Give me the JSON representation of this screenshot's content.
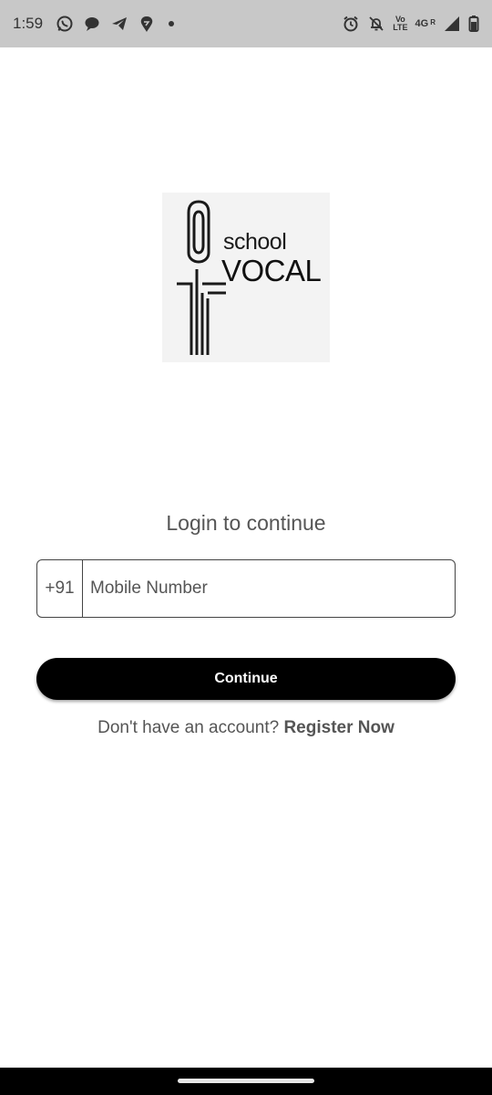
{
  "status_bar": {
    "time": "1:59",
    "left_icons": [
      "whatsapp-icon",
      "chat-bubble-icon",
      "telegram-icon",
      "swiggy-icon",
      "more-dot-icon"
    ],
    "right_icons": [
      "alarm-icon",
      "notification-off-icon",
      "volte-icon",
      "signal-icon",
      "battery-icon"
    ],
    "volte_top": "Vo",
    "volte_bottom": "LTE",
    "network": "4G",
    "roaming": "R"
  },
  "logo": {
    "line1": "school",
    "line2": "VOCAL"
  },
  "login": {
    "heading": "Login to continue",
    "country_code": "+91",
    "mobile_placeholder": "Mobile Number",
    "mobile_value": "",
    "continue_label": "Continue",
    "register_prompt": "Don't have an account? ",
    "register_link": "Register Now"
  },
  "colors": {
    "primary_button": "#000000",
    "status_bar": "#c8c8c8",
    "text_gray": "#555555"
  }
}
